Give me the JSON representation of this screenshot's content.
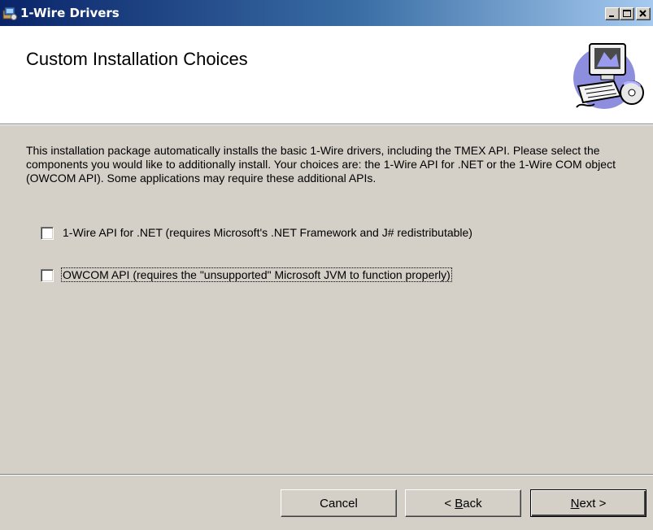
{
  "window": {
    "title": "1-Wire Drivers",
    "icon": "installer-icon",
    "controls": [
      "minimize-icon",
      "maximize-icon",
      "close-icon"
    ]
  },
  "header": {
    "title": "Custom Installation Choices",
    "icon": "computer-cd-icon"
  },
  "description": "This installation package automatically installs the basic 1-Wire drivers, including the TMEX API. Please select the components you would like to additionally install.  Your choices are:  the 1-Wire API for .NET or the 1-Wire COM object (OWCOM API).  Some applications may require these additional APIs.",
  "options": [
    {
      "label": "1-Wire API for .NET (requires Microsoft's .NET Framework and J# redistributable)",
      "checked": false
    },
    {
      "label": "OWCOM API (requires the \"unsupported\" Microsoft JVM to function properly)",
      "checked": false
    }
  ],
  "buttons": {
    "cancel": "Cancel",
    "back_prefix": "< ",
    "back_key": "B",
    "back_rest": "ack",
    "next_key": "N",
    "next_rest": "ext >"
  },
  "colors": {
    "titlebar_start": "#0a246a",
    "titlebar_end": "#a6caf0",
    "dialog_face": "#d4d0c8"
  }
}
